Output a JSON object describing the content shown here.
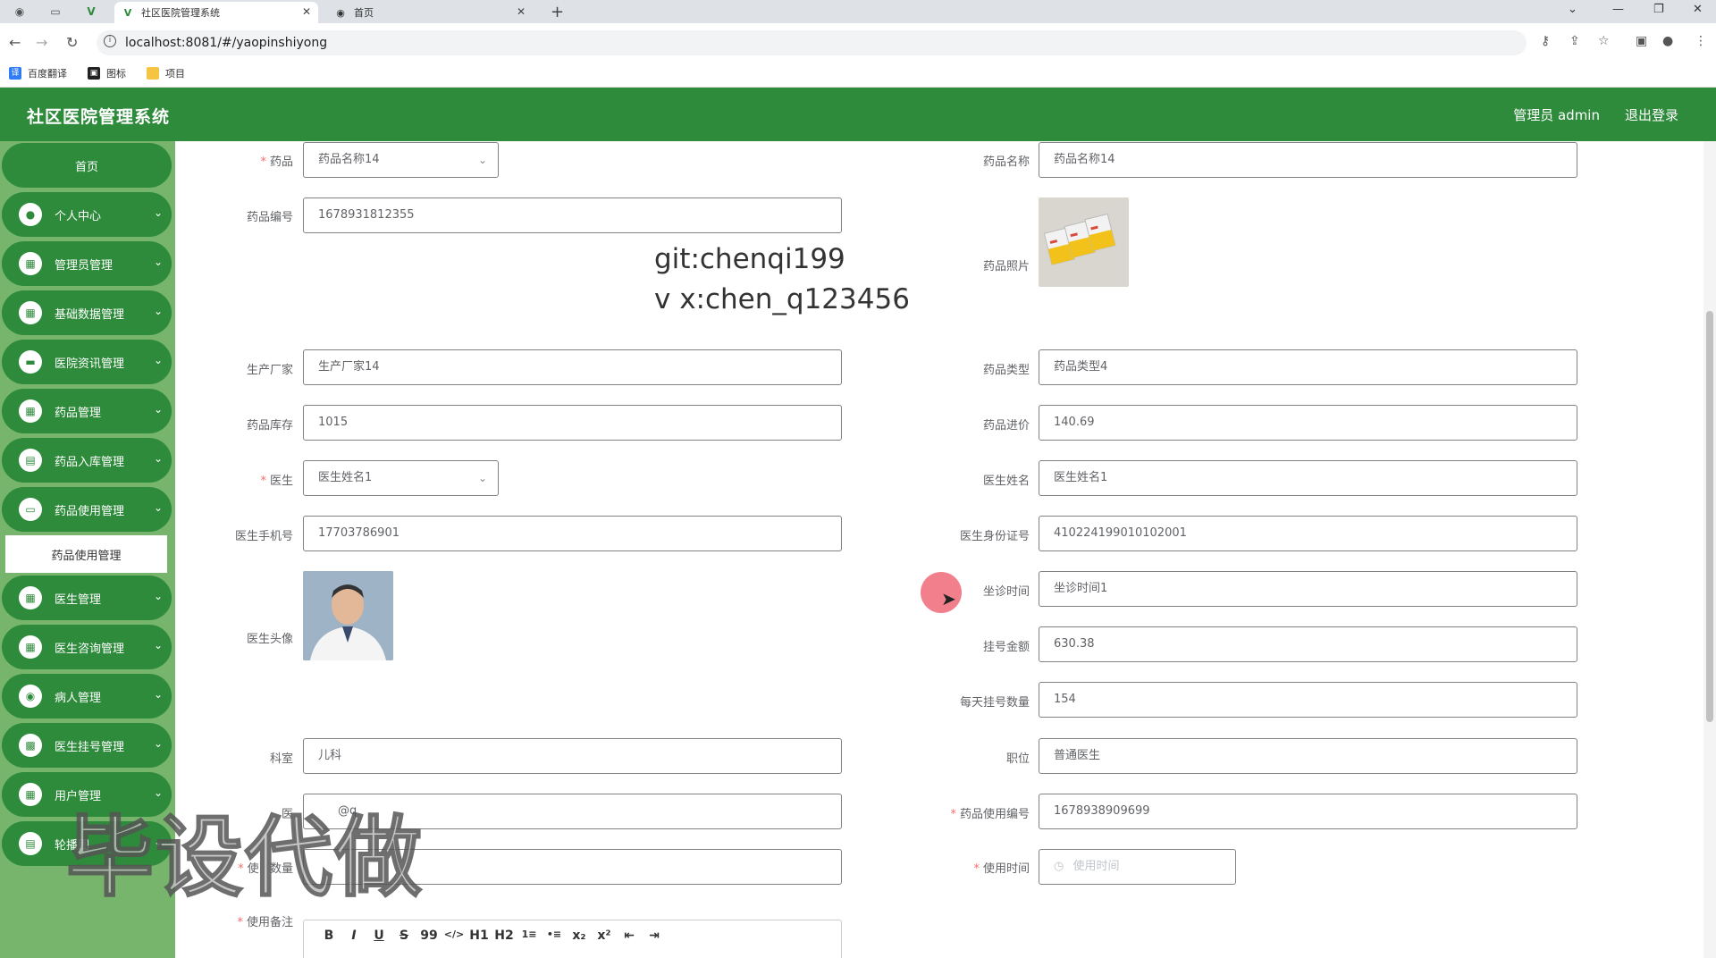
{
  "browser": {
    "tabs": [
      {
        "title": "社区医院管理系统",
        "icon": "vue-logo-icon",
        "active": true
      },
      {
        "title": "首页",
        "icon": "globe-icon",
        "active": false
      }
    ],
    "url": "localhost:8081/#/yaopinshiyong",
    "bookmarks": [
      {
        "label": "百度翻译",
        "icon": "translate-icon",
        "color": "#2f7cf6"
      },
      {
        "label": "图标",
        "icon": "image-icon",
        "color": "#222222"
      },
      {
        "label": "项目",
        "icon": "folder-icon",
        "color": "#f5c542"
      }
    ]
  },
  "header": {
    "title": "社区医院管理系统",
    "user": "管理员 admin",
    "logout": "退出登录",
    "color": "#2e8b3b"
  },
  "sidebar": {
    "home": "首页",
    "items": [
      {
        "label": "个人中心",
        "icon": "user-icon"
      },
      {
        "label": "管理员管理",
        "icon": "grid-icon"
      },
      {
        "label": "基础数据管理",
        "icon": "grid-icon"
      },
      {
        "label": "医院资讯管理",
        "icon": "monitor-icon"
      },
      {
        "label": "药品管理",
        "icon": "grid-icon"
      },
      {
        "label": "药品入库管理",
        "icon": "box-icon"
      },
      {
        "label": "药品使用管理",
        "icon": "chat-icon"
      },
      {
        "label": "医生管理",
        "icon": "grid-icon"
      },
      {
        "label": "医生咨询管理",
        "icon": "grid-icon"
      },
      {
        "label": "病人管理",
        "icon": "location-icon"
      },
      {
        "label": "医生挂号管理",
        "icon": "ticket-icon"
      },
      {
        "label": "用户管理",
        "icon": "grid-icon"
      },
      {
        "label": "轮播图",
        "icon": "doc-icon"
      }
    ],
    "active_sub": "药品使用管理"
  },
  "form": {
    "drug_select_label": "药品",
    "drug_select_value": "药品名称14",
    "drug_name_label": "药品名称",
    "drug_name_value": "药品名称14",
    "drug_code_label": "药品编号",
    "drug_code_value": "1678931812355",
    "drug_photo_label": "药品照片",
    "manufacturer_label": "生产厂家",
    "manufacturer_value": "生产厂家14",
    "drug_type_label": "药品类型",
    "drug_type_value": "药品类型4",
    "stock_label": "药品库存",
    "stock_value": "1015",
    "price_label": "药品进价",
    "price_value": "140.69",
    "doctor_select_label": "医生",
    "doctor_select_value": "医生姓名1",
    "doctor_name_label": "医生姓名",
    "doctor_name_value": "医生姓名1",
    "doctor_phone_label": "医生手机号",
    "doctor_phone_value": "17703786901",
    "doctor_id_label": "医生身份证号",
    "doctor_id_value": "410224199010102001",
    "doctor_avatar_label": "医生头像",
    "clinic_time_label": "坐诊时间",
    "clinic_time_value": "坐诊时间1",
    "fee_label": "挂号金额",
    "fee_value": "630.38",
    "daily_count_label": "每天挂号数量",
    "daily_count_value": "154",
    "department_label": "科室",
    "department_value": "儿科",
    "position_label": "职位",
    "position_value": "普通医生",
    "email_label_visible": "医",
    "email_value_visible": "@q",
    "use_code_label": "药品使用编号",
    "use_code_value": "1678938909699",
    "use_qty_label_visible": "使",
    "use_qty_label_tail": "数量",
    "use_time_label": "使用时间",
    "use_time_placeholder": "使用时间",
    "note_label": "使用备注"
  },
  "editor_tools": [
    "B",
    "I",
    "U",
    "S",
    "99",
    "</>",
    "H1",
    "H2",
    "1≡",
    "•≡",
    "x₂",
    "x²",
    "⇤",
    "⇥"
  ],
  "overlay": {
    "line1": "git:chenqi199",
    "line2": "v x:chen_q123456",
    "big": "毕设代做"
  }
}
